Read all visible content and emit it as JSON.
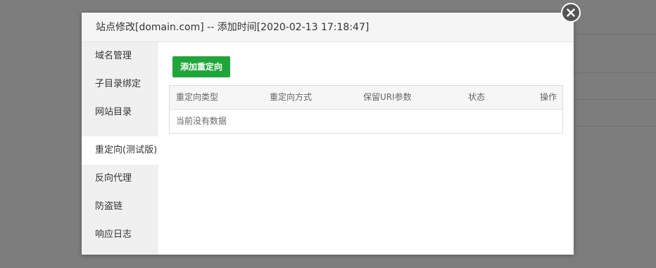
{
  "modal": {
    "title": "站点修改[domain.com] -- 添加时间[2020-02-13 17:18:47]"
  },
  "sidebar": {
    "items": [
      {
        "label": "域名管理"
      },
      {
        "label": "子目录绑定"
      },
      {
        "label": "网站目录"
      },
      {
        "label": ""
      },
      {
        "label": "重定向(测试版)"
      },
      {
        "label": "反向代理"
      },
      {
        "label": "防盗链"
      },
      {
        "label": "响应日志"
      }
    ],
    "active_index": 4
  },
  "content": {
    "add_button_label": "添加重定向",
    "table": {
      "headers": [
        "重定向类型",
        "重定向方式",
        "保留URI参数",
        "状态",
        "操作"
      ],
      "empty_text": "当前没有数据"
    }
  },
  "colors": {
    "accent": "#20a53a",
    "overlay": "#7d7d7d",
    "sidebar_bg": "#f0f0f0",
    "header_bg": "#f5f5f5"
  },
  "icons": {
    "close": "close-icon"
  }
}
